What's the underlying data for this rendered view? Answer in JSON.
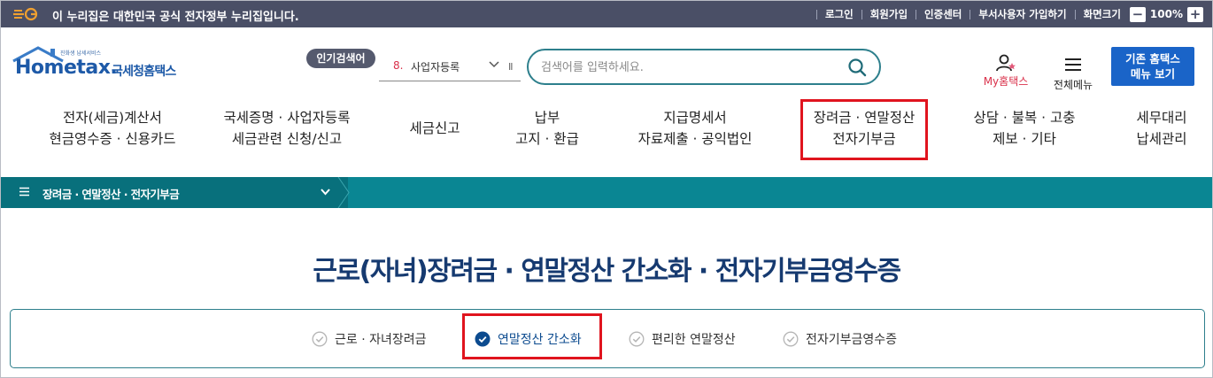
{
  "gov_bar": {
    "notice": "이 누리집은 대한민국 공식 전자정부 누리집입니다.",
    "links": [
      "로그인",
      "회원가입",
      "인증센터",
      "부서사용자 가입하기",
      "화면크기"
    ],
    "zoom_minus": "−",
    "zoom_value": "100%",
    "zoom_plus": "+"
  },
  "header": {
    "logo_tagline": "진화생 납세서비스",
    "logo_text": "Hometax.",
    "logo_korean": "국세청홈택스",
    "popular_badge": "인기검색어",
    "popular_rank": "8.",
    "popular_word": "사업자등록",
    "popular_pause": "II",
    "search_placeholder": "검색어를 입력하세요.",
    "my_hometax": "My홈택스",
    "all_menu": "전체메뉴",
    "old_menu_line1": "기존 홈택스",
    "old_menu_line2": "메뉴 보기"
  },
  "gnb": [
    {
      "line1": "전자(세금)계산서",
      "line2": "현금영수증 · 신용카드"
    },
    {
      "line1": "국세증명 · 사업자등록",
      "line2": "세금관련 신청/신고"
    },
    {
      "line1": "세금신고",
      "line2": ""
    },
    {
      "line1": "납부",
      "line2": "고지 · 환급"
    },
    {
      "line1": "지급명세서",
      "line2": "자료제출 · 공익법인"
    },
    {
      "line1": "장려금 · 연말정산",
      "line2": "전자기부금"
    },
    {
      "line1": "상담 · 불복 · 고충",
      "line2": "제보 · 기타"
    },
    {
      "line1": "세무대리",
      "line2": "납세관리"
    }
  ],
  "breadcrumb": {
    "label": "장려금 · 연말정산 · 전자기부금"
  },
  "page_title": "근로(자녀)장려금 · 연말정산 간소화 · 전자기부금영수증",
  "tabs": [
    {
      "label": "근로 · 자녀장려금",
      "active": false
    },
    {
      "label": "연말정산 간소화",
      "active": true
    },
    {
      "label": "편리한 연말정산",
      "active": false
    },
    {
      "label": "전자기부금영수증",
      "active": false
    }
  ],
  "colors": {
    "gov_bar": "#4a4f66",
    "brand_blue": "#1e5aa8",
    "teal": "#0a8693",
    "highlight_red": "#e0141e",
    "title_navy": "#163a70"
  }
}
